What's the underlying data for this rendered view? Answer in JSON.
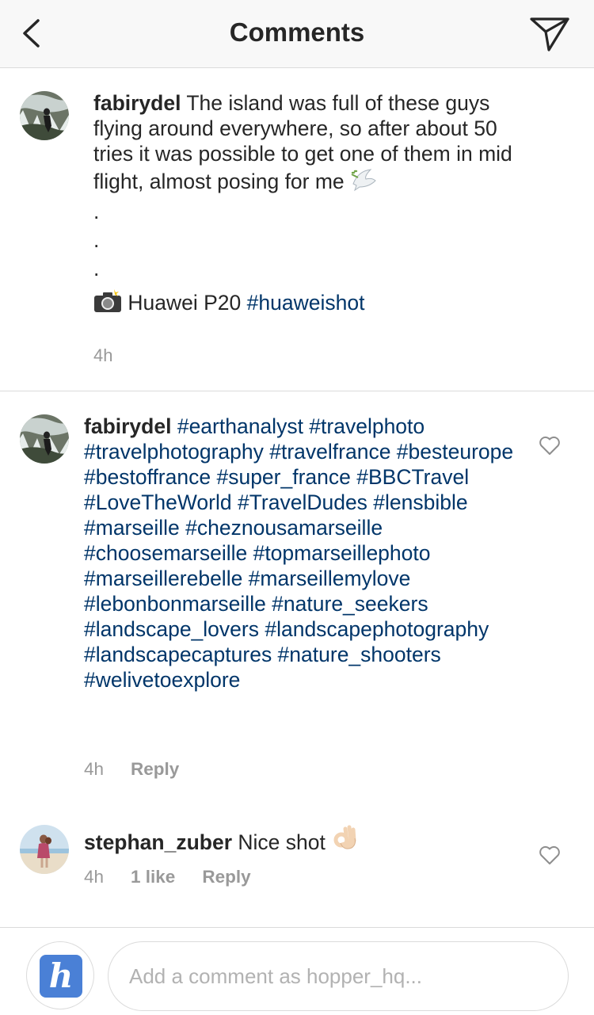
{
  "header": {
    "title": "Comments"
  },
  "caption": {
    "username": "fabirydel",
    "text": "The island was full of these guys flying around everywhere, so after about 50 tries it was possible to get one of them in mid flight, almost posing for me",
    "dots": [
      ".",
      ".",
      "."
    ],
    "camera_text": "Huawei P20",
    "hashtag": "#huaweishot",
    "time": "4h"
  },
  "comments": [
    {
      "username": "fabirydel",
      "hashtags": "#earthanalyst #travelphoto #travelphotography #travelfrance #besteurope #bestoffrance #super_france #BBCTravel #LoveTheWorld #TravelDudes #lensbible #marseille #cheznousamarseille #choosemarseille #topmarseillephoto #marseillerebelle #marseillemylove #lebonbonmarseille #nature_seekers #landscape_lovers #landscapephotography #landscapecaptures #nature_shooters #welivetoexplore",
      "time": "4h",
      "reply_label": "Reply"
    },
    {
      "username": "stephan_zuber",
      "text": "Nice shot",
      "time": "4h",
      "likes": "1 like",
      "reply_label": "Reply"
    }
  ],
  "footer": {
    "avatar_letter": "h",
    "placeholder": "Add a comment as hopper_hq..."
  },
  "colors": {
    "hashtag": "#003569",
    "meta": "#999999",
    "divider": "#dbdbdb",
    "logo": "#4a80d6"
  }
}
